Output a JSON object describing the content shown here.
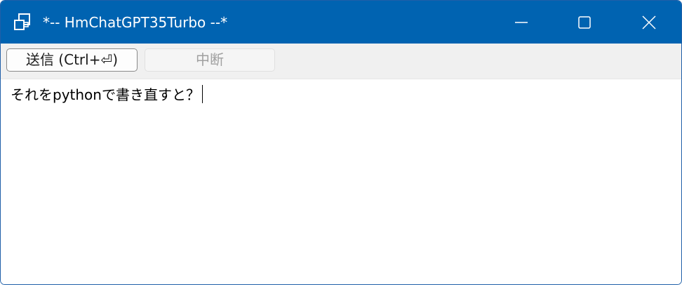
{
  "window": {
    "title": "*-- HmChatGPT35Turbo --*",
    "accent": "#0063b1"
  },
  "titlebar": {
    "icon": "app-windows-icon",
    "minimize_icon": "minimize-icon",
    "maximize_icon": "maximize-icon",
    "close_icon": "close-icon"
  },
  "toolbar": {
    "send_label": "送信 (Ctrl+⏎)",
    "stop_label": "中断"
  },
  "editor": {
    "value": "それをpythonで書き直すと？"
  }
}
